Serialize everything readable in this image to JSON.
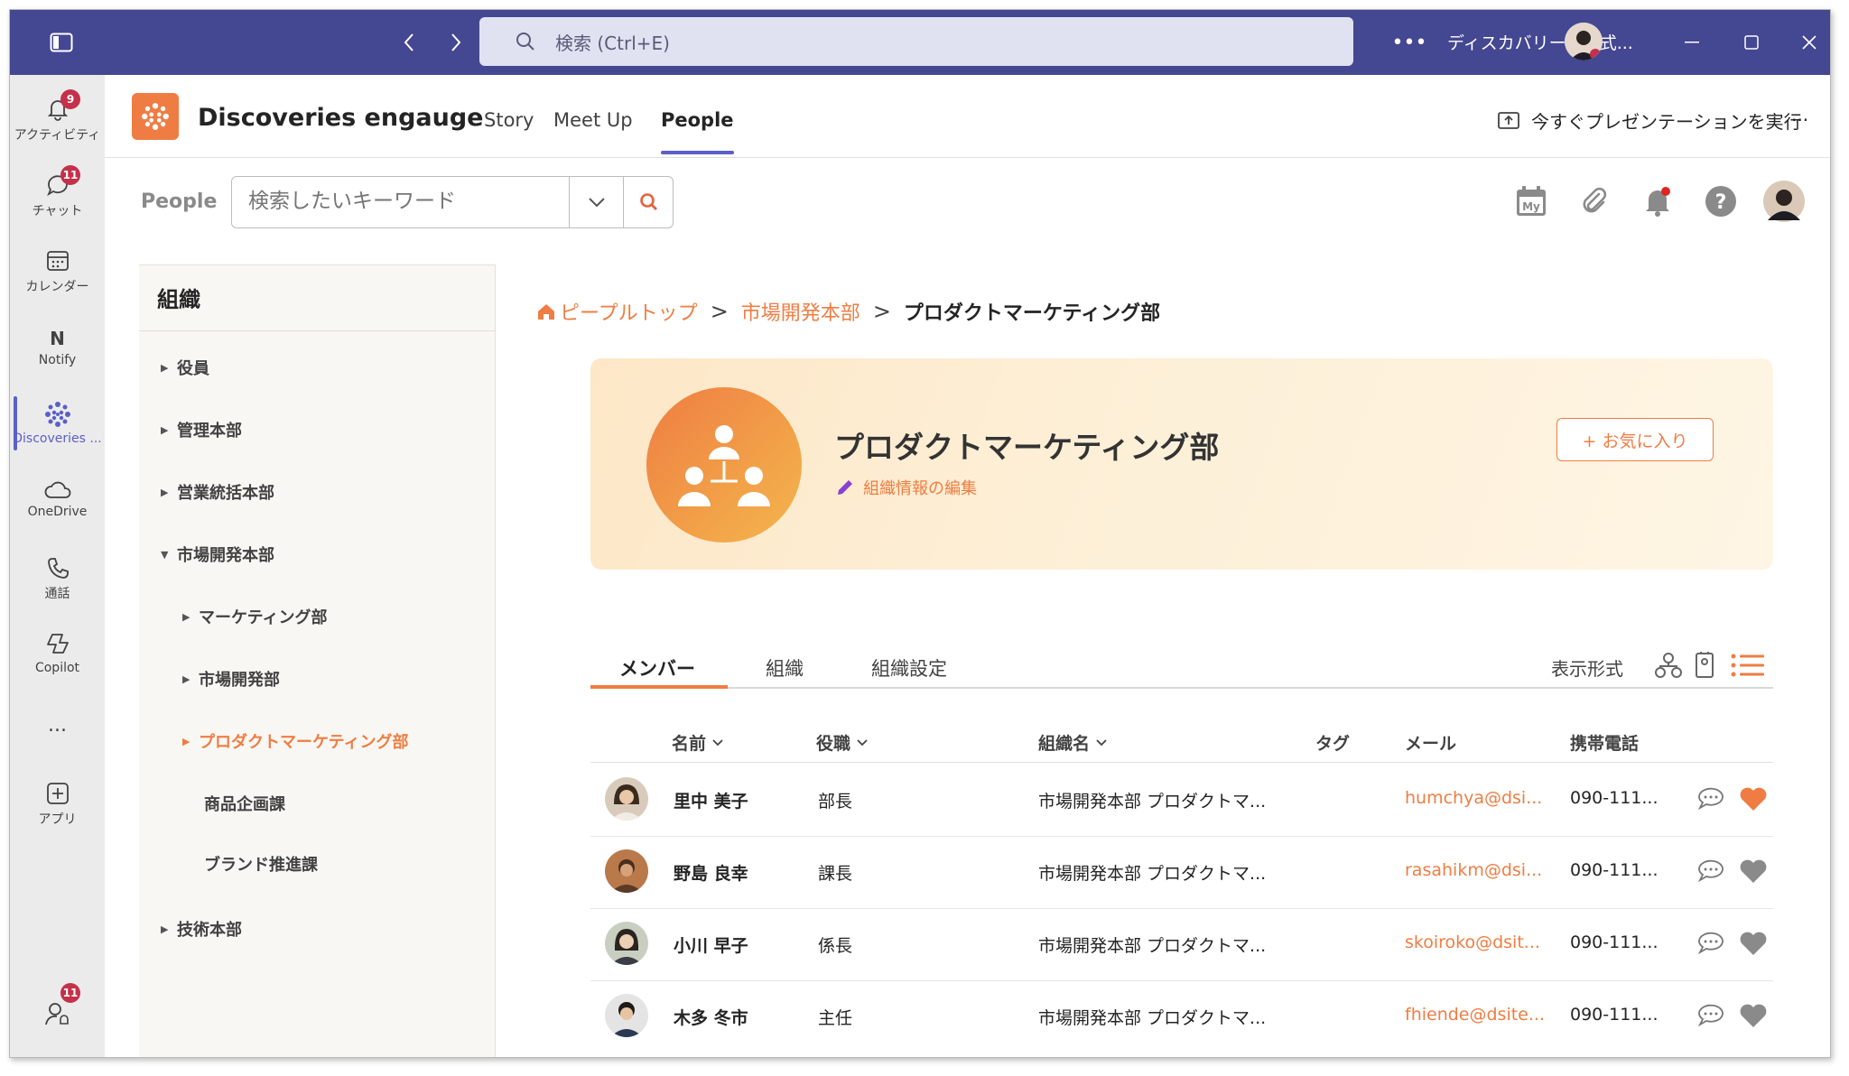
{
  "titlebar": {
    "search_placeholder": "検索 (Ctrl+E)",
    "tenant": "ディスカバリーズ株式..."
  },
  "rail": [
    {
      "label": "アクティビティ",
      "icon": "bell-icon",
      "badge": "9"
    },
    {
      "label": "チャット",
      "icon": "chat-icon",
      "badge": "11"
    },
    {
      "label": "カレンダー",
      "icon": "calendar-icon",
      "badge": ""
    },
    {
      "label": "Notify",
      "icon": "notify-icon",
      "badge": ""
    },
    {
      "label": "Discoveries ...",
      "icon": "discoveries-icon",
      "badge": ""
    },
    {
      "label": "OneDrive",
      "icon": "cloud-icon",
      "badge": ""
    },
    {
      "label": "通話",
      "icon": "phone-icon",
      "badge": ""
    },
    {
      "label": "Copilot",
      "icon": "copilot-icon",
      "badge": ""
    },
    {
      "label": "アプリ",
      "icon": "apps-icon",
      "badge": ""
    }
  ],
  "rail_more": "...",
  "rail_bottom_badge": "11",
  "app": {
    "name": "Discoveries engauge",
    "tabs": [
      "Story",
      "Meet Up",
      "People"
    ],
    "active_tab": "People",
    "present_label": "今すぐプレゼンテーションを実行",
    "more": "..."
  },
  "toolbar": {
    "section_label": "People",
    "keyword_placeholder": "検索したいキーワード",
    "my_label": "My"
  },
  "sidebar": {
    "title": "組織",
    "items": [
      {
        "label": "役員",
        "caret": "▶",
        "level": 0
      },
      {
        "label": "管理本部",
        "caret": "▶",
        "level": 0
      },
      {
        "label": "営業統括本部",
        "caret": "▶",
        "level": 0
      },
      {
        "label": "市場開発本部",
        "caret": "▼",
        "level": 0
      },
      {
        "label": "マーケティング部",
        "caret": "▶",
        "level": 1
      },
      {
        "label": "市場開発部",
        "caret": "▶",
        "level": 1
      },
      {
        "label": "プロダクトマーケティング部",
        "caret": "▶",
        "level": 1,
        "current": true
      },
      {
        "label": "商品企画課",
        "caret": "",
        "level": 2
      },
      {
        "label": "ブランド推進課",
        "caret": "",
        "level": 2
      },
      {
        "label": "技術本部",
        "caret": "▶",
        "level": 0
      }
    ]
  },
  "breadcrumb": {
    "home": "ピープルトップ",
    "parent": "市場開発本部",
    "current": "プロダクトマーケティング部",
    "sep": ">"
  },
  "banner": {
    "title": "プロダクトマーケティング部",
    "edit_label": "組織情報の編集",
    "favorite_label": "+ お気に入り"
  },
  "tabs": {
    "items": [
      "メンバー",
      "組織",
      "組織設定"
    ],
    "active": "メンバー",
    "display_label": "表示形式"
  },
  "table": {
    "headers": [
      "名前",
      "役職",
      "組織名",
      "タグ",
      "メール",
      "携帯電話"
    ],
    "rows": [
      {
        "name": "里中 美子",
        "role": "部長",
        "org": "市場開発本部 プロダクトマ...",
        "tag": "",
        "mail": "humchya@dsi...",
        "phone": "090-111...",
        "favorite": true
      },
      {
        "name": "野島 良幸",
        "role": "課長",
        "org": "市場開発本部 プロダクトマ...",
        "tag": "",
        "mail": "rasahikm@dsi...",
        "phone": "090-111...",
        "favorite": false
      },
      {
        "name": "小川 早子",
        "role": "係長",
        "org": "市場開発本部 プロダクトマ...",
        "tag": "",
        "mail": "skoiroko@dsit...",
        "phone": "090-111...",
        "favorite": false
      },
      {
        "name": "木多 冬市",
        "role": "主任",
        "org": "市場開発本部 プロダクトマ...",
        "tag": "",
        "mail": "fhiende@dsite...",
        "phone": "090-111...",
        "favorite": false
      }
    ]
  },
  "colors": {
    "titlebar": "#444791",
    "accent": "#ef7d43",
    "teams_purple": "#5b5fc7",
    "fav_active": "#ef7d43",
    "fav_inactive": "#8a8a8a"
  }
}
